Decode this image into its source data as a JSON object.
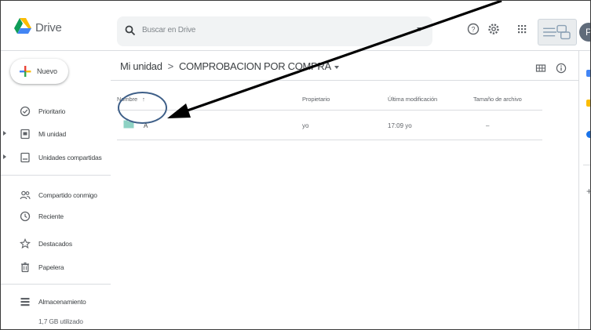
{
  "header": {
    "app_title": "Drive",
    "search_placeholder": "Buscar en Drive",
    "avatar_initial": "P"
  },
  "sidebar": {
    "new_label": "Nuevo",
    "items": [
      {
        "label": "Prioritario",
        "icon": "check-circle-icon",
        "arrow": false
      },
      {
        "label": "Mi unidad",
        "icon": "my-drive-icon",
        "arrow": true
      },
      {
        "label": "Unidades compartidas",
        "icon": "shared-drives-icon",
        "arrow": true
      },
      {
        "label": "Compartido conmigo",
        "icon": "people-icon",
        "arrow": false
      },
      {
        "label": "Reciente",
        "icon": "clock-icon",
        "arrow": false
      },
      {
        "label": "Destacados",
        "icon": "star-icon",
        "arrow": false
      },
      {
        "label": "Papelera",
        "icon": "trash-icon",
        "arrow": false
      },
      {
        "label": "Almacenamiento",
        "icon": "storage-icon",
        "arrow": false
      }
    ],
    "storage_used": "1,7 GB utilizado"
  },
  "breadcrumb": {
    "root": "Mi unidad",
    "separator": ">",
    "current": "COMPROBACION POR COMPRA"
  },
  "table": {
    "columns": [
      "Nombre",
      "Propietario",
      "Última modificación",
      "Tamaño de archivo"
    ],
    "sort_indicator": "↑",
    "rows": [
      {
        "name": "A",
        "owner": "yo",
        "modified": "17:09 yo",
        "size": "–"
      }
    ]
  },
  "colors": {
    "folder": "#8ed2c4",
    "accent_blue": "#1a73e8",
    "annotation_circle": "#3e5f88",
    "annotation_arrow": "#000000"
  }
}
